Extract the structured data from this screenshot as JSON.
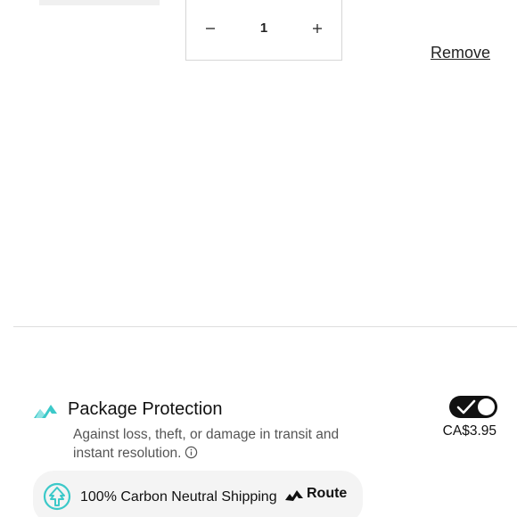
{
  "cart_item": {
    "quantity": "1",
    "decrease_icon": "minus-icon",
    "increase_icon": "plus-icon",
    "remove_label": "Remove"
  },
  "package_protection": {
    "logo_icon": "route-logo-icon",
    "title": "Package Protection",
    "description": "Against loss, theft, or damage in transit and instant resolution.",
    "info_icon": "info-icon",
    "enabled": true,
    "price": "CA$3.95",
    "accent_color": "#3cc9c9"
  },
  "carbon_badge": {
    "icon": "tree-arrow-icon",
    "label": "100% Carbon Neutral Shipping",
    "brand_icon": "route-logo-icon",
    "brand_label": "Route"
  }
}
